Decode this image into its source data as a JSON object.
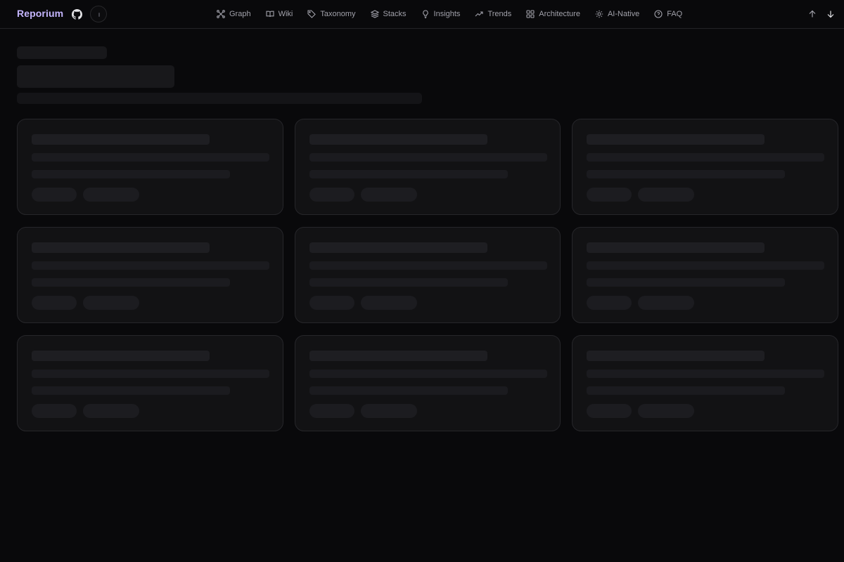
{
  "brand": {
    "name": "Reporium"
  },
  "nav": {
    "items": [
      {
        "label": "Graph",
        "icon": "graph-icon"
      },
      {
        "label": "Wiki",
        "icon": "book-icon"
      },
      {
        "label": "Taxonomy",
        "icon": "tag-icon"
      },
      {
        "label": "Stacks",
        "icon": "layers-icon"
      },
      {
        "label": "Insights",
        "icon": "lightbulb-icon"
      },
      {
        "label": "Trends",
        "icon": "trending-up-icon"
      },
      {
        "label": "Architecture",
        "icon": "grid-icon"
      },
      {
        "label": "AI-Native",
        "icon": "sun-icon"
      },
      {
        "label": "FAQ",
        "icon": "help-circle-icon"
      }
    ]
  },
  "toolbar_icons": [
    "github-icon",
    "arrow-up-icon",
    "arrow-down-icon"
  ],
  "state": "loading-skeleton",
  "colors": {
    "brand": "#c4b5fd",
    "background": "#09090b",
    "card": "#121214",
    "border": "#26262a"
  }
}
